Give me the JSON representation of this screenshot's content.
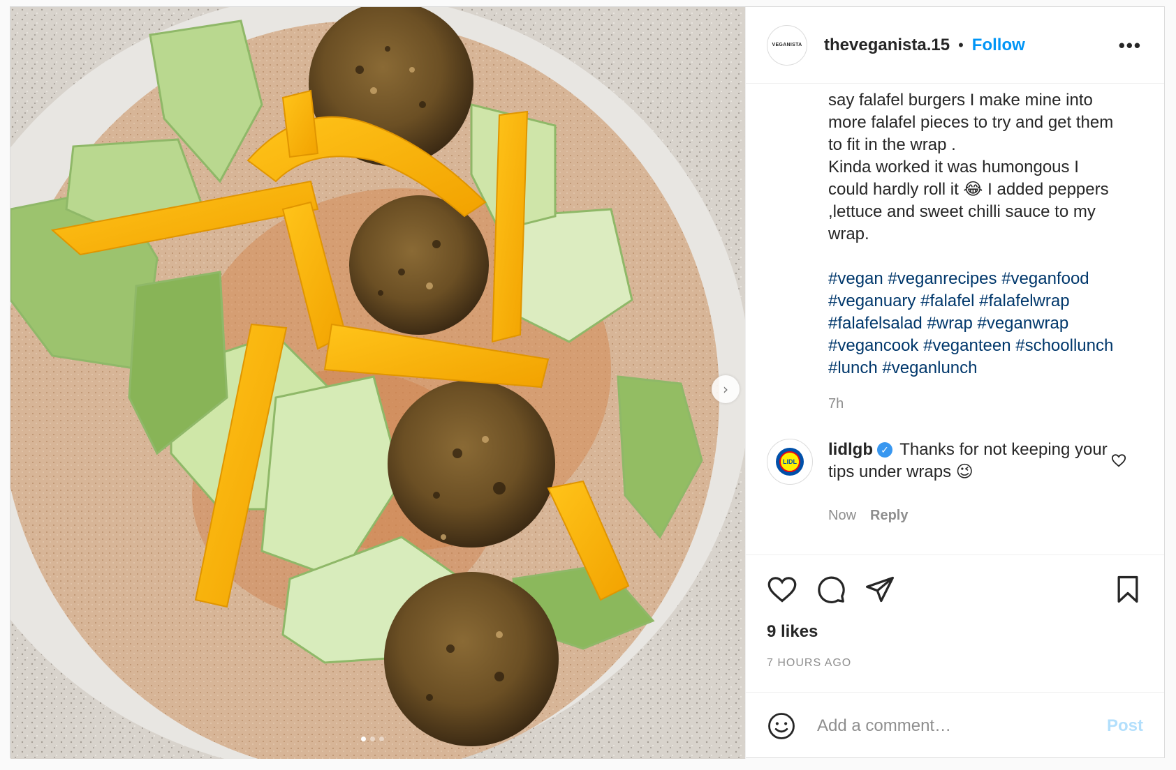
{
  "post": {
    "username": "theveganista.15",
    "avatar_text": "VEGANISTA",
    "follow_label": "Follow",
    "separator": "•",
    "more_label": "•••",
    "caption_lines": [
      "say falafel burgers I make mine into",
      "more falafel pieces to try and get them",
      "to fit in the wrap .",
      "Kinda worked it was humongous I",
      "could hardly roll it 😂 I added peppers",
      ",lettuce and sweet chilli sauce to my",
      "wrap."
    ],
    "hashtags": [
      "#vegan",
      "#veganrecipes",
      "#veganfood",
      "#veganuary",
      "#falafel",
      "#falafelwrap",
      "#falafelsalad",
      "#wrap",
      "#veganwrap",
      "#vegancook",
      "#veganteen",
      "#schoollunch",
      "#lunch",
      "#veganlunch"
    ],
    "caption_time": "7h"
  },
  "comment": {
    "username": "lidlgb",
    "avatar_text": "LIDL",
    "verified_mark": "✓",
    "text": "Thanks for not keeping your tips under wraps 😉",
    "time": "Now",
    "reply_label": "Reply"
  },
  "actions": {
    "icons": [
      "heart-icon",
      "comment-icon",
      "share-icon",
      "bookmark-icon"
    ],
    "likes": "9 likes",
    "timestamp": "7 HOURS AGO"
  },
  "composer": {
    "placeholder": "Add a comment…",
    "post_label": "Post"
  },
  "media": {
    "next_label": "›",
    "slides": 3,
    "active_slide": 0
  },
  "colors": {
    "link_blue": "#0095f6",
    "hashtag": "#00376b",
    "muted": "#8e8e8e",
    "post_disabled": "#b2dffc"
  }
}
